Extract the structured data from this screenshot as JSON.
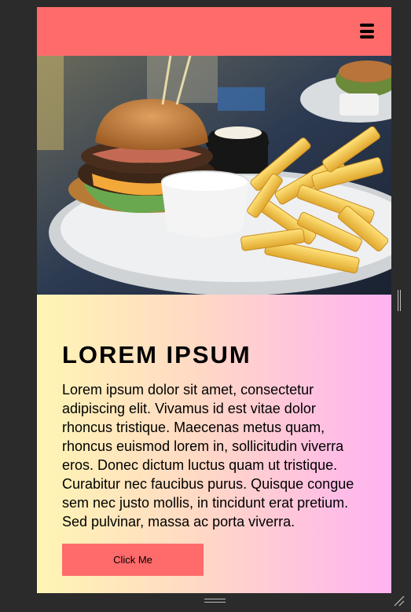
{
  "navbar": {
    "menu_icon": "hamburger-menu-icon",
    "background": "#ff6b6b"
  },
  "hero": {
    "image": "burger-and-fries-photo"
  },
  "content": {
    "title": "LOREM IPSUM",
    "body": "Lorem ipsum dolor sit amet, consectetur adipiscing elit. Vivamus id est vitae dolor rhoncus tristique. Maecenas metus quam, rhoncus euismod lorem in, sollicitudin viverra eros. Donec dictum luctus quam ut tristique. Curabitur nec faucibus purus. Quisque congue sem nec justo mollis, in tincidunt erat pretium. Sed pulvinar, massa ac porta viverra.",
    "button_label": "Click Me",
    "gradient": [
      "#fff5b4",
      "#ffb2f2"
    ]
  },
  "resize_handles": {
    "side": "vertical-grip-icon",
    "bottom": "horizontal-grip-icon",
    "corner": "resize-corner-icon"
  }
}
